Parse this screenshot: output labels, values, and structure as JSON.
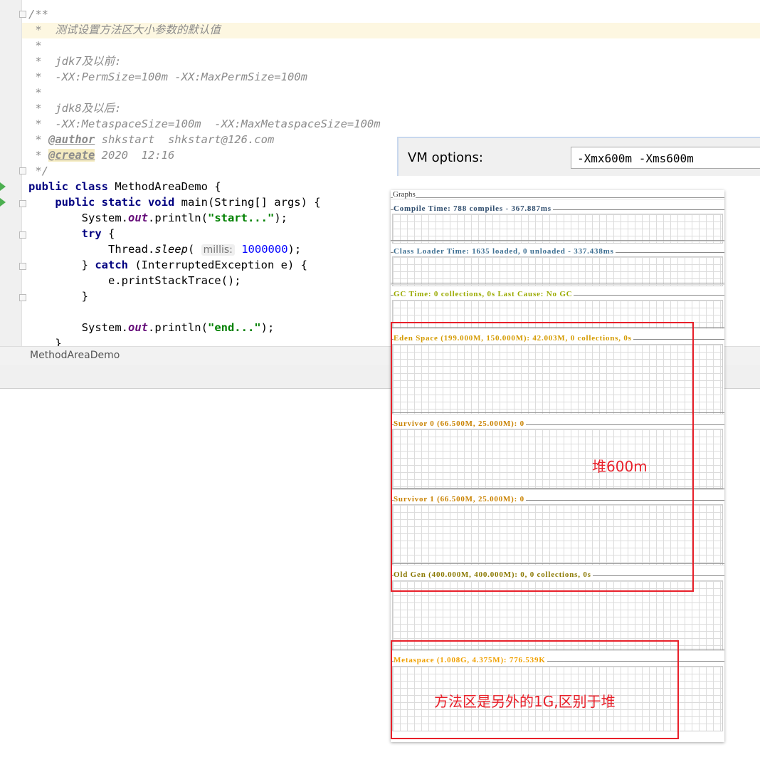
{
  "editor": {
    "lines": [
      [
        [
          "/**",
          "cm"
        ]
      ],
      [
        [
          " *  测试设置方法区大小参数的默认值",
          "cm"
        ]
      ],
      [
        [
          " *",
          "cm"
        ]
      ],
      [
        [
          " *  jdk7及以前:",
          "cm"
        ]
      ],
      [
        [
          " *  -XX:PermSize=100m -XX:MaxPermSize=100m",
          "cm"
        ]
      ],
      [
        [
          " *",
          "cm"
        ]
      ],
      [
        [
          " *  jdk8及以后:",
          "cm"
        ]
      ],
      [
        [
          " *  -XX:MetaspaceSize=100m  -XX:MaxMetaspaceSize=100m",
          "cm"
        ]
      ],
      [
        [
          " * ",
          "cm"
        ],
        [
          "@author",
          "tag"
        ],
        [
          " shkstart  shkstart@126.com",
          "cm"
        ]
      ],
      [
        [
          " * ",
          "cm"
        ],
        [
          "@create",
          "tagc"
        ],
        [
          " 2020  12:16",
          "cm"
        ]
      ],
      [
        [
          " */",
          "cm"
        ]
      ],
      [
        [
          "public class",
          "kw"
        ],
        [
          " MethodAreaDemo {",
          ""
        ]
      ],
      [
        [
          "    ",
          ""
        ],
        [
          "public static void",
          "kw"
        ],
        [
          " main(String[] args) {",
          ""
        ]
      ],
      [
        [
          "        System.",
          ""
        ],
        [
          "out",
          "fld"
        ],
        [
          ".println(",
          ""
        ],
        [
          "\"start...\"",
          "st"
        ],
        [
          ");",
          ""
        ]
      ],
      [
        [
          "        ",
          ""
        ],
        [
          "try",
          "kw"
        ],
        [
          " {",
          ""
        ]
      ],
      [
        [
          "            Thread.",
          ""
        ],
        [
          "sleep",
          "it"
        ],
        [
          "( ",
          ""
        ],
        [
          "millis:",
          "hint"
        ],
        [
          " ",
          ""
        ],
        [
          "1000000",
          "num"
        ],
        [
          ");",
          ""
        ]
      ],
      [
        [
          "        } ",
          ""
        ],
        [
          "catch",
          "kw"
        ],
        [
          " (InterruptedException e) {",
          ""
        ]
      ],
      [
        [
          "            e.printStackTrace();",
          ""
        ]
      ],
      [
        [
          "        }",
          ""
        ]
      ],
      [
        [
          "",
          ""
        ]
      ],
      [
        [
          "        System.",
          ""
        ],
        [
          "out",
          "fld"
        ],
        [
          ".println(",
          ""
        ],
        [
          "\"end...\"",
          "st"
        ],
        [
          ");",
          ""
        ]
      ],
      [
        [
          "    }",
          ""
        ]
      ]
    ],
    "tab_label": "MethodAreaDemo"
  },
  "vm_options": {
    "label": "VM options:",
    "value": "-Xmx600m -Xms600m"
  },
  "graphs": {
    "title": "Graphs",
    "sections": [
      {
        "label": "Compile Time: 788 compiles - 367.887ms",
        "color": "#2f4d6e"
      },
      {
        "label": "Class Loader Time: 1635 loaded, 0 unloaded - 337.438ms",
        "color": "#3d6f92"
      },
      {
        "label": "GC Time: 0 collections, 0s Last Cause: No GC",
        "color": "#9aaa00"
      },
      {
        "label": "Eden Space (199.000M, 150.000M): 42.003M, 0 collections, 0s",
        "color": "#d49a00"
      },
      {
        "label": "Survivor 0 (66.500M, 25.000M): 0",
        "color": "#c98200"
      },
      {
        "label": "Survivor 1 (66.500M, 25.000M): 0",
        "color": "#c98200"
      },
      {
        "label": "Old Gen (400.000M, 400.000M): 0, 0 collections, 0s",
        "color": "#8a7800"
      },
      {
        "label": "Metaspace (1.008G, 4.375M): 776.539K",
        "color": "#f0a000"
      }
    ]
  },
  "annotations": {
    "heap": "堆600m",
    "method_area": "方法区是另外的1G,区别于堆",
    "color": "#e8202a"
  }
}
